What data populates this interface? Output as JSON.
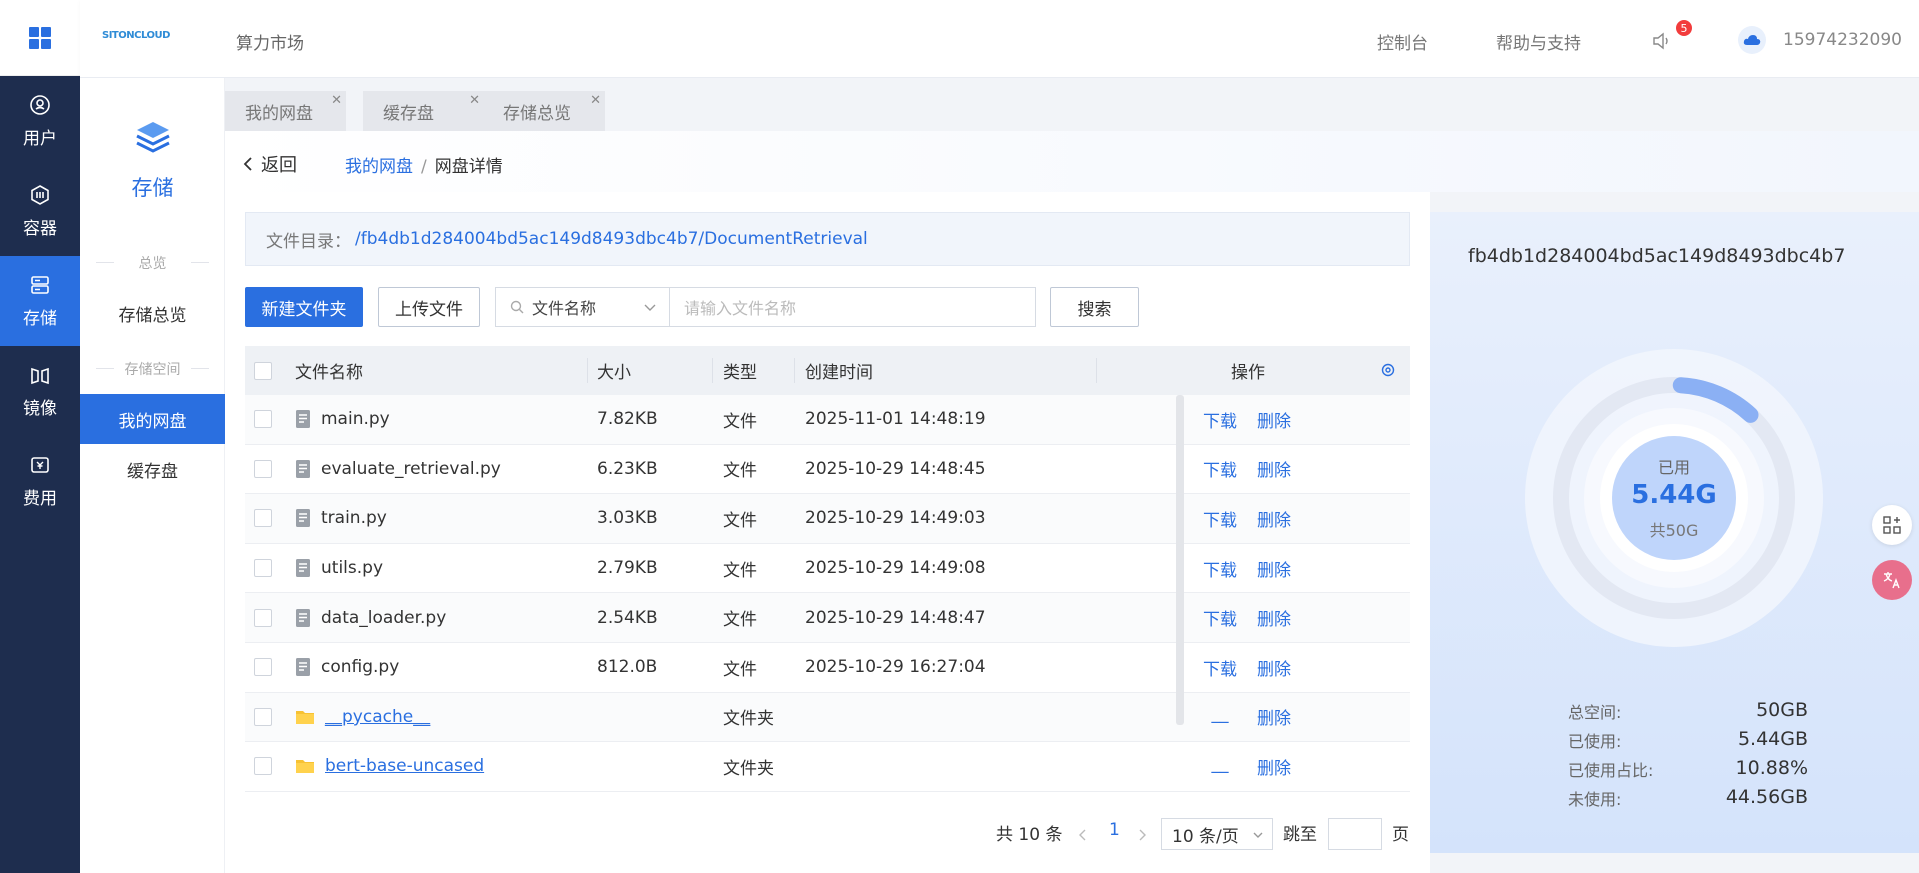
{
  "nav_rail": {
    "items": [
      {
        "label": "用户",
        "icon": "user-icon"
      },
      {
        "label": "容器",
        "icon": "container-icon"
      },
      {
        "label": "存储",
        "icon": "storage-icon",
        "active": true
      },
      {
        "label": "镜像",
        "icon": "image-icon"
      },
      {
        "label": "费用",
        "icon": "billing-icon"
      }
    ]
  },
  "header": {
    "brand": "SITONCLOUD",
    "market": "算力市场",
    "console": "控制台",
    "help": "帮助与支持",
    "notification_count": "5",
    "phone": "15974232090"
  },
  "subnav": {
    "title": "存储",
    "group_overview": "总览",
    "item_overview": "存储总览",
    "group_space": "存储空间",
    "item_netdisk": "我的网盘",
    "item_cache": "缓存盘"
  },
  "tabs": [
    {
      "label": "我的网盘"
    },
    {
      "label": "缓存盘"
    },
    {
      "label": "存储总览"
    }
  ],
  "breadcrumb": {
    "back": "返回",
    "parent": "我的网盘",
    "separator": "/",
    "current": "网盘详情"
  },
  "directory": {
    "label": "文件目录：",
    "path": "/fb4db1d284004bd5ac149d8493dbc4b7/DocumentRetrieval"
  },
  "toolbar": {
    "new_folder": "新建文件夹",
    "upload": "上传文件",
    "select_value": "文件名称",
    "search_placeholder": "请输入文件名称",
    "search": "搜索"
  },
  "table": {
    "headers": {
      "name": "文件名称",
      "size": "大小",
      "type": "类型",
      "created": "创建时间",
      "ops": "操作"
    },
    "rows": [
      {
        "name": "main.py",
        "size": "7.82KB",
        "type": "文件",
        "created": "2025-11-01 14:48:19",
        "download": "下载",
        "delete": "删除",
        "kind": "file"
      },
      {
        "name": "evaluate_retrieval.py",
        "size": "6.23KB",
        "type": "文件",
        "created": "2025-10-29 14:48:45",
        "download": "下载",
        "delete": "删除",
        "kind": "file"
      },
      {
        "name": "train.py",
        "size": "3.03KB",
        "type": "文件",
        "created": "2025-10-29 14:49:03",
        "download": "下载",
        "delete": "删除",
        "kind": "file"
      },
      {
        "name": "utils.py",
        "size": "2.79KB",
        "type": "文件",
        "created": "2025-10-29 14:49:08",
        "download": "下载",
        "delete": "删除",
        "kind": "file"
      },
      {
        "name": "data_loader.py",
        "size": "2.54KB",
        "type": "文件",
        "created": "2025-10-29 14:48:47",
        "download": "下载",
        "delete": "删除",
        "kind": "file"
      },
      {
        "name": "config.py",
        "size": "812.0B",
        "type": "文件",
        "created": "2025-10-29 16:27:04",
        "download": "下载",
        "delete": "删除",
        "kind": "file"
      },
      {
        "name": "__pycache__",
        "size": "",
        "type": "文件夹",
        "created": "",
        "download": "__",
        "delete": "删除",
        "kind": "folder"
      },
      {
        "name": "bert-base-uncased",
        "size": "",
        "type": "文件夹",
        "created": "",
        "download": "__",
        "delete": "删除",
        "kind": "folder"
      }
    ]
  },
  "pagination": {
    "total": "共 10 条",
    "current_page": "1",
    "page_size": "10 条/页",
    "jump_label": "跳至",
    "page_suffix": "页"
  },
  "storage": {
    "id": "fb4db1d284004bd5ac149d8493dbc4b7",
    "used_label": "已用",
    "used_value": "5.44G",
    "total_label": "共50G",
    "used_fraction": 0.1088,
    "stats": [
      {
        "label": "总空间:",
        "value": "50GB"
      },
      {
        "label": "已使用:",
        "value": "5.44GB"
      },
      {
        "label": "已使用占比:",
        "value": "10.88%"
      },
      {
        "label": "未使用:",
        "value": "44.56GB"
      }
    ]
  },
  "colors": {
    "primary": "#2a6fe0",
    "rail_bg": "#1e2d4e",
    "badge": "#f23c3c"
  }
}
